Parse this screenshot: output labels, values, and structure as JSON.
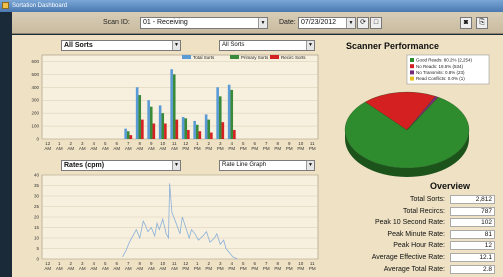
{
  "window": {
    "title": "Sortation Dashboard"
  },
  "toolbar": {
    "scan_label": "Scan ID:",
    "scan_value": "01 - Receiving",
    "date_label": "Date:",
    "date_value": "07/23/2012"
  },
  "top_chart": {
    "selector": "All Sorts",
    "filter": "All Sorts"
  },
  "bottom_chart": {
    "selector": "Rates (cpm)",
    "mode": "Rate Line Graph"
  },
  "scanner_performance": {
    "title": "Scanner Performance",
    "legend": [
      "Good Reads: 80.2% (2,254)",
      "No Reads: 19.5% (534)",
      "No Transmits: 0.8% (23)",
      "Read Conflicts: 0.0% (1)"
    ],
    "colors": [
      "#2e8b2e",
      "#d42020",
      "#7a2a7a",
      "#e8c020"
    ]
  },
  "overview": {
    "title": "Overview",
    "rows": [
      {
        "label": "Total Sorts:",
        "value": "2,812"
      },
      {
        "label": "Total Recircs:",
        "value": "787"
      },
      {
        "label": "Peak 10 Second Rate:",
        "value": "102"
      },
      {
        "label": "Peak Minute Rate:",
        "value": "81"
      },
      {
        "label": "Peak Hour Rate:",
        "value": "12"
      },
      {
        "label": "Average Effective Rate:",
        "value": "12.1"
      },
      {
        "label": "Average Total Rate:",
        "value": "2.8"
      }
    ]
  },
  "chart_data": [
    {
      "type": "bar",
      "series": [
        {
          "name": "Total Sorts",
          "color": "#5a9ad6",
          "values": [
            0,
            0,
            0,
            0,
            0,
            0,
            0,
            80,
            400,
            300,
            260,
            540,
            170,
            140,
            190,
            400,
            420,
            0,
            0,
            0,
            0,
            0,
            0,
            0
          ]
        },
        {
          "name": "Primary Sorts",
          "color": "#3a8a3a",
          "values": [
            0,
            0,
            0,
            0,
            0,
            0,
            0,
            60,
            340,
            250,
            200,
            500,
            160,
            110,
            150,
            330,
            380,
            0,
            0,
            0,
            0,
            0,
            0,
            0
          ]
        },
        {
          "name": "Recirc Sorts",
          "color": "#d42020",
          "values": [
            0,
            0,
            0,
            0,
            0,
            0,
            0,
            30,
            150,
            120,
            120,
            150,
            70,
            60,
            50,
            130,
            70,
            0,
            0,
            0,
            0,
            0,
            0,
            0
          ]
        }
      ],
      "categories": [
        "12 AM",
        "1 AM",
        "2 AM",
        "3 AM",
        "4 AM",
        "5 AM",
        "6 AM",
        "7 AM",
        "8 AM",
        "9 AM",
        "10 AM",
        "11 AM",
        "12 PM",
        "1 PM",
        "2 PM",
        "3 PM",
        "4 PM",
        "5 PM",
        "6 PM",
        "7 PM",
        "8 PM",
        "9 PM",
        "10 PM",
        "11 PM"
      ],
      "yticks": [
        0,
        100,
        200,
        300,
        400,
        500,
        600
      ],
      "ylim": [
        0,
        650
      ]
    },
    {
      "type": "line",
      "x_hours": [
        7,
        7.3,
        7.6,
        8,
        8.2,
        8.5,
        8.8,
        9,
        9.2,
        9.5,
        9.8,
        10,
        10.2,
        10.5,
        10.8,
        11,
        11.1,
        11.3,
        11.6,
        12,
        12.2,
        12.5,
        12.8,
        13,
        13.3,
        13.6,
        14,
        14.3,
        14.6,
        15,
        15.2,
        15.5,
        15.8,
        16,
        16.3,
        16.6,
        17
      ],
      "y": [
        1,
        4,
        8,
        12,
        14,
        10,
        18,
        16,
        13,
        15,
        11,
        17,
        14,
        19,
        12,
        10,
        36,
        22,
        18,
        12,
        20,
        15,
        10,
        14,
        12,
        9,
        11,
        13,
        8,
        10,
        12,
        7,
        9,
        5,
        3,
        1,
        0
      ],
      "x_labels": [
        "12 AM",
        "1 AM",
        "2 AM",
        "3 AM",
        "4 AM",
        "5 AM",
        "6 AM",
        "7 AM",
        "8 AM",
        "9 AM",
        "10 AM",
        "11 AM",
        "12 PM",
        "1 PM",
        "2 PM",
        "3 PM",
        "4 PM",
        "5 PM",
        "6 PM",
        "7 PM",
        "8 PM",
        "9 PM",
        "10 PM",
        "11 PM"
      ],
      "yticks": [
        0,
        5,
        10,
        15,
        20,
        25,
        30,
        35,
        40
      ],
      "ylim": [
        0,
        40
      ],
      "color": "#8ab0d8"
    },
    {
      "type": "pie",
      "slices": [
        {
          "label": "Good Reads",
          "value": 80.2,
          "color": "#2e8b2e"
        },
        {
          "label": "No Reads",
          "value": 19.5,
          "color": "#d42020"
        },
        {
          "label": "No Transmits",
          "value": 0.8,
          "color": "#7a2a7a"
        },
        {
          "label": "Read Conflicts",
          "value": 0.1,
          "color": "#e8c020"
        }
      ]
    }
  ]
}
